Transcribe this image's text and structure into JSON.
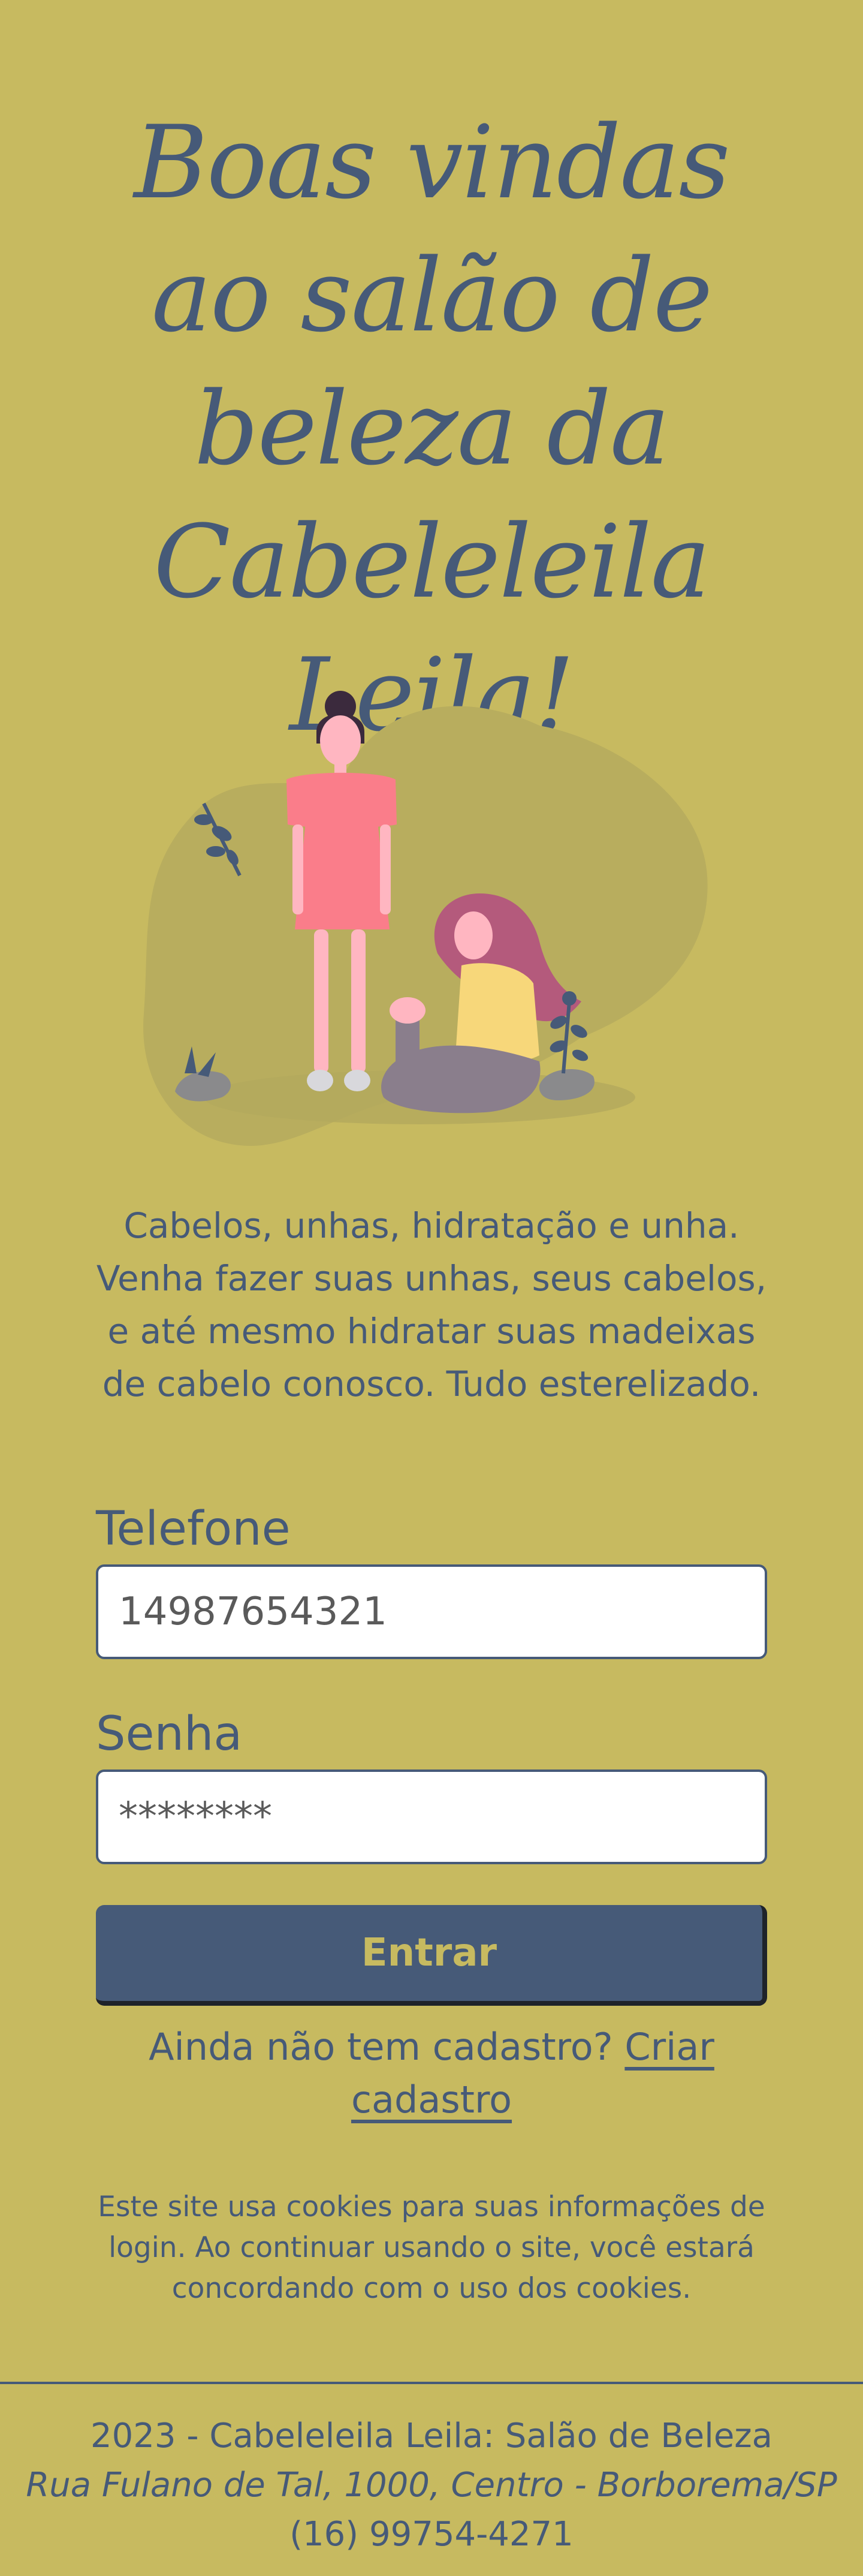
{
  "header": {
    "title": "Boas vindas ao salão de beleza da Cabeleleila Leila!"
  },
  "hero": {
    "illustration_icon": "women-salon-illustration"
  },
  "intro": {
    "text": "Cabelos, unhas, hidratação e unha. Venha fazer suas unhas, seus cabelos, e até mesmo hidratar suas madeixas de cabelo conosco. Tudo esterelizado."
  },
  "login": {
    "phone_label": "Telefone",
    "phone_value": "14987654321",
    "password_label": "Senha",
    "password_value": "********",
    "submit_label": "Entrar"
  },
  "signup": {
    "prompt": "Ainda não tem cadastro?",
    "link_label": "Criar cadastro"
  },
  "cookies": {
    "text": "Este site usa cookies para suas informações de login. Ao continuar usando o site, você estará concordando com o uso dos cookies."
  },
  "footer": {
    "copyright": "2023 - Cabeleleila Leila: Salão de Beleza",
    "address": "Rua Fulano de Tal, 1000, Centro - Borborema/SP",
    "phone": "(16) 99754-4271"
  },
  "colors": {
    "background": "#c7ba60",
    "primary": "#465a78",
    "button_text": "#c7ba60",
    "input_background": "#ffffff"
  }
}
